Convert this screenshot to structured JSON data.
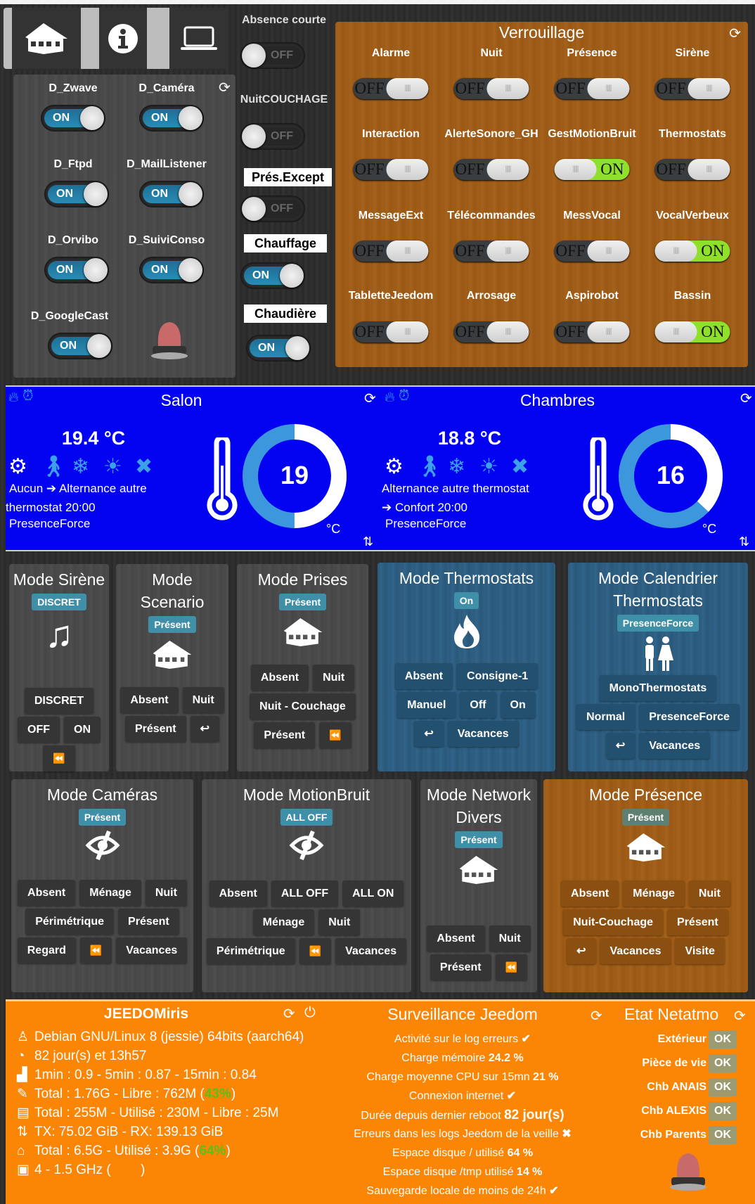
{
  "nav": {
    "items": [
      {
        "icon": "home-icon"
      },
      {
        "icon": "info-icon"
      },
      {
        "icon": "laptop-icon"
      }
    ]
  },
  "daemons": {
    "items": [
      {
        "label": "D_Zwave",
        "state": "ON"
      },
      {
        "label": "D_Caméra",
        "state": "ON"
      },
      {
        "label": "D_Ftpd",
        "state": "ON"
      },
      {
        "label": "D_MailListener",
        "state": "ON"
      },
      {
        "label": "D_Orvibo",
        "state": "ON"
      },
      {
        "label": "D_SuiviConso",
        "state": "ON"
      },
      {
        "label": "D_GoogleCast",
        "state": "ON"
      }
    ]
  },
  "modes_switches": [
    {
      "label": "Absence courte",
      "state": "OFF",
      "boxed": false
    },
    {
      "label": "NuitCOUCHAGE",
      "state": "OFF",
      "boxed": false
    },
    {
      "label": "Prés.Except",
      "state": "OFF",
      "boxed": true
    },
    {
      "label": "Chauffage",
      "state": "ON",
      "boxed": true
    },
    {
      "label": "Chaudière",
      "state": "ON",
      "boxed": true
    }
  ],
  "verrouillage": {
    "title": "Verrouillage",
    "items": [
      {
        "label": "Alarme",
        "state": "OFF"
      },
      {
        "label": "Nuit",
        "state": "OFF"
      },
      {
        "label": "Présence",
        "state": "OFF"
      },
      {
        "label": "Sirène",
        "state": "OFF"
      },
      {
        "label": "Interaction",
        "state": "OFF"
      },
      {
        "label": "AlerteSonore_GH",
        "state": "OFF"
      },
      {
        "label": "GestMotionBruit",
        "state": "ON"
      },
      {
        "label": "Thermostats",
        "state": "OFF"
      },
      {
        "label": "MessageExt",
        "state": "OFF"
      },
      {
        "label": "Télécommandes",
        "state": "OFF"
      },
      {
        "label": "MessVocal",
        "state": "OFF"
      },
      {
        "label": "VocalVerbeux",
        "state": "ON"
      },
      {
        "label": "TabletteJeedom",
        "state": "OFF"
      },
      {
        "label": "Arrosage",
        "state": "OFF"
      },
      {
        "label": "Aspirobot",
        "state": "OFF"
      },
      {
        "label": "Bassin",
        "state": "ON"
      }
    ]
  },
  "thermostats": [
    {
      "name": "Salon",
      "temperature": "19.4 °C",
      "setpoint": "19",
      "unit": "°C",
      "gauge_fill": 0.5,
      "line1_a": "Aucun",
      "line1_b": "Alternance autre",
      "line2": "thermostat 20:00",
      "line3": "PresenceForce"
    },
    {
      "name": "Chambres",
      "temperature": "18.8 °C",
      "setpoint": "16",
      "unit": "°C",
      "gauge_fill": 0.37,
      "line1_a": "",
      "line1_b": "Alternance autre thermostat",
      "line2": "Confort 20:00",
      "line3": "PresenceForce"
    }
  ],
  "modes": [
    {
      "title": "Mode Sirène",
      "badge": "DISCRET",
      "icon": "music-icon",
      "rows": [
        [
          "DISCRET"
        ],
        [
          "OFF",
          "ON"
        ],
        [
          "⏪"
        ]
      ]
    },
    {
      "title": "Mode Scenario",
      "badge": "Présent",
      "icon": "house-icon",
      "rows": [
        [
          "Absent",
          "Nuit"
        ],
        [
          "Présent",
          "↩"
        ]
      ]
    },
    {
      "title": "Mode Prises",
      "badge": "Présent",
      "icon": "house-icon",
      "rows": [
        [
          "Absent",
          "Nuit"
        ],
        [
          "Nuit - Couchage"
        ],
        [
          "Présent",
          "⏪"
        ]
      ]
    },
    {
      "title": "Mode Thermostats",
      "badge": "On",
      "icon": "flame-icon",
      "rows": [
        [
          "Absent",
          "Consigne-1"
        ],
        [
          "Manuel",
          "Off",
          "On"
        ],
        [
          "↩",
          "Vacances"
        ]
      ]
    },
    {
      "title": "Mode Calendrier Thermostats",
      "badge": "PresenceForce",
      "icon": "people-icon",
      "rows": [
        [
          "MonoThermostats"
        ],
        [
          "Normal",
          "PresenceForce"
        ],
        [
          "↩",
          "Vacances"
        ]
      ]
    },
    {
      "title": "Mode Caméras",
      "badge": "Présent",
      "icon": "eye-slash-icon",
      "rows": [
        [
          "Absent",
          "Ménage",
          "Nuit"
        ],
        [
          "Périmétrique",
          "Présent"
        ],
        [
          "Regard",
          "⏪",
          "Vacances"
        ]
      ]
    },
    {
      "title": "Mode MotionBruit",
      "badge": "ALL OFF",
      "icon": "eye-slash-icon",
      "rows": [
        [
          "Absent",
          "ALL OFF",
          "ALL ON"
        ],
        [
          "Ménage",
          "Nuit"
        ],
        [
          "Périmétrique",
          "⏪",
          "Vacances"
        ]
      ]
    },
    {
      "title": "Mode Network Divers",
      "badge": "Présent",
      "icon": "house-icon",
      "rows": [
        [
          "Absent",
          "Nuit"
        ],
        [
          "Présent",
          "⏪"
        ]
      ]
    },
    {
      "title": "Mode Présence",
      "badge": "Présent",
      "icon": "house-icon",
      "rows": [
        [
          "Absent",
          "Ménage",
          "Nuit"
        ],
        [
          "Nuit-Couchage",
          "Présent"
        ],
        [
          "↩",
          "Vacances",
          "Visite"
        ]
      ]
    }
  ],
  "jeedomiris": {
    "title": "JEEDOMiris",
    "lines": [
      {
        "icon": "linux-icon",
        "glyph": "♙",
        "pre": "Debian GNU/Linux 8 (jessie) 64bits (aarch64)",
        "hl": "",
        "post": ""
      },
      {
        "icon": "dashboard-icon",
        "glyph": "◔",
        "pre": "82 jour(s) et 13h57",
        "hl": "",
        "post": ""
      },
      {
        "icon": "area-chart-icon",
        "glyph": "▟",
        "pre": "1min : 0.9 - 5min : 0.87 - 15min : 0.84",
        "hl": "",
        "post": ""
      },
      {
        "icon": "memory-icon",
        "glyph": "✎",
        "pre": "Total : 1.76G - Libre : 762M (",
        "hl": "43%",
        "post": ")"
      },
      {
        "icon": "swap-icon",
        "glyph": "▤",
        "pre": "Total : 255M - Utilisé : 230M - Libre : 25M",
        "hl": "",
        "post": ""
      },
      {
        "icon": "network-icon",
        "glyph": "⇅",
        "pre": "TX: 75.02 GiB - RX: 139.13 GiB",
        "hl": "",
        "post": ""
      },
      {
        "icon": "hdd-icon",
        "glyph": "⌂",
        "pre": "Total : 6.5G - Utilisé : 3.9G (",
        "hl": "64%",
        "post": ")"
      },
      {
        "icon": "cpu-icon",
        "glyph": "▣",
        "pre": "4 - 1.5 GHz (",
        "hl": "",
        "post": "        )"
      }
    ]
  },
  "surveillance": {
    "title": "Surveillance Jeedom",
    "lines": [
      {
        "text": "Activité sur le log erreurs",
        "bold": "",
        "mark": "✔"
      },
      {
        "text": "Charge mémoire",
        "bold": "24.2 %",
        "mark": ""
      },
      {
        "text": "Charge moyenne CPU sur 15mn",
        "bold": "21 %",
        "mark": ""
      },
      {
        "text": "Connexion internet",
        "bold": "",
        "mark": "✔"
      },
      {
        "text": "Durée depuis dernier reboot",
        "bold": "82 jour(s)",
        "mark": ""
      },
      {
        "text": "Erreurs dans les logs Jeedom de la veille",
        "bold": "",
        "mark": "✖"
      },
      {
        "text": "Espace disque / utilisé",
        "bold": "64 %",
        "mark": ""
      },
      {
        "text": "Espace disque /tmp utilisé",
        "bold": "14 %",
        "mark": ""
      },
      {
        "text": "Sauvegarde locale de moins de 24h",
        "bold": "",
        "mark": "✔"
      }
    ]
  },
  "netatmo": {
    "title": "Etat Netatmo",
    "items": [
      {
        "label": "Extérieur",
        "status": "OK"
      },
      {
        "label": "Pièce de vie",
        "status": "OK"
      },
      {
        "label": "Chb ANAIS",
        "status": "OK"
      },
      {
        "label": "Chb ALEXIS",
        "status": "OK"
      },
      {
        "label": "Chb Parents",
        "status": "OK"
      }
    ]
  },
  "colors": {
    "blue_band": "#0303f2",
    "orange_band": "#fb8505",
    "wood": "#a05c18",
    "toggle_on": "#2a8bb5",
    "lock_on": "#8fe02a",
    "badge": "#3f8fa8"
  }
}
